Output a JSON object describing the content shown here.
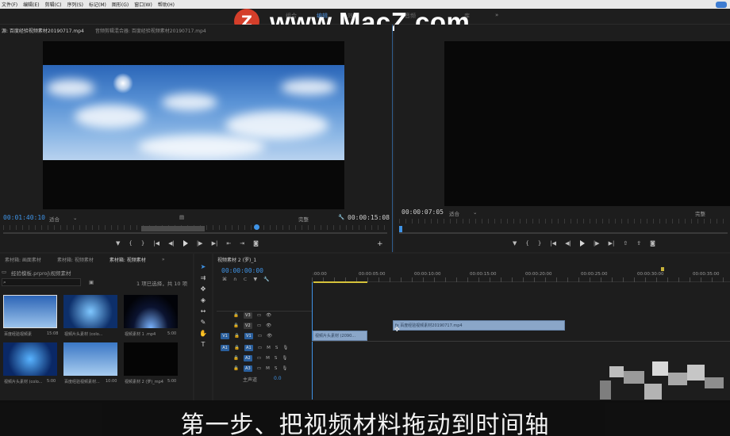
{
  "menu": [
    "文件(F)",
    "编辑(E)",
    "剪辑(C)",
    "序列(S)",
    "标记(M)",
    "图形(G)",
    "窗口(W)",
    "帮助(H)"
  ],
  "workspaces": {
    "items": [
      "组合",
      "编辑",
      "效果",
      "音频",
      "库"
    ],
    "active": "编辑"
  },
  "watermark": {
    "badge_letter": "Z",
    "text": "www.MacZ.com"
  },
  "source_monitor": {
    "tab_active": "源: 百度经验视频素材20190717.mp4",
    "tab_2": "音频剪辑混合器: 百度经验视频素材20190717.mp4",
    "timecode_in": "00:01:40:10",
    "fit": "适合",
    "quality": "完整",
    "timecode_out": "00:00:15:08"
  },
  "program_monitor": {
    "timecode": "00:00:07:05",
    "fit": "适合",
    "quality": "完整"
  },
  "project_panel": {
    "tabs": [
      "素材箱: 画面素材",
      "素材箱: 视频素材",
      "素材箱: 视频素材"
    ],
    "project_name": "经验模板.prproj\\视频素材",
    "search_placeholder": "",
    "selection_info": "1 项已选择，共 10 项",
    "items": [
      {
        "label": "百度经验视频素",
        "duration": "15:08"
      },
      {
        "label": "视频片头素材 (colo...",
        "duration": ""
      },
      {
        "label": "视频素材 1 .mp4",
        "duration": "5:00"
      },
      {
        "label": "视频片头素材 (colo...",
        "duration": "5:00"
      },
      {
        "label": "百度经验视频素材...",
        "duration": "10:00"
      },
      {
        "label": "视频素材 2 (罗)_mp4",
        "duration": "5:00"
      }
    ]
  },
  "timeline": {
    "tab": "视频素材 2 (罗)_1",
    "timecode": "00:00:00:00",
    "ruler_labels": [
      ":00:00",
      "00:00:05:00",
      "00:00:10:00",
      "00:00:15:00",
      "00:00:20:00",
      "00:00:25:00",
      "00:00:30:00",
      "00:00:35:00"
    ],
    "tracks_video": [
      "V3",
      "V2",
      "V1"
    ],
    "tracks_audio": [
      "A1",
      "A2",
      "A3"
    ],
    "master_label": "主声道",
    "master_value": "0.0",
    "clip_v1": "视频片头素材 (2090...",
    "clip_v2": "fx 百度经验视频素材20190717.mp4",
    "src_v1": "V1",
    "src_a1": "A1"
  },
  "subtitle": "第一步、把视频材料拖动到时间轴",
  "colors": {
    "accent": "#3f93e6",
    "panel_bg": "#1d1d1d",
    "clip": "#8aa6c8",
    "watermark_badge": "#d43e2a"
  }
}
